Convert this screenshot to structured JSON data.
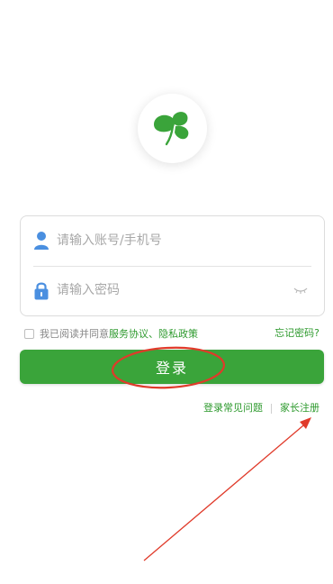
{
  "login_form": {
    "account_placeholder": "请输入账号/手机号",
    "password_placeholder": "请输入密码"
  },
  "agreement": {
    "prefix": "我已阅读并同意",
    "terms_link": "服务协议",
    "separator": "、",
    "privacy_link": "隐私政策"
  },
  "forgot_password": "忘记密码?",
  "login_button": "登录",
  "bottom_links": {
    "faq": "登录常见问题",
    "parent_register": "家长注册"
  },
  "icons": {
    "logo": "clover-leaf-logo",
    "account": "user-icon",
    "password": "lock-icon",
    "toggle": "eye-closed-icon"
  },
  "colors": {
    "brand_green": "#3aa43a",
    "link_green": "#2e9a2e",
    "icon_blue": "#4a8fe0",
    "annotation_red": "#e03a2a"
  }
}
